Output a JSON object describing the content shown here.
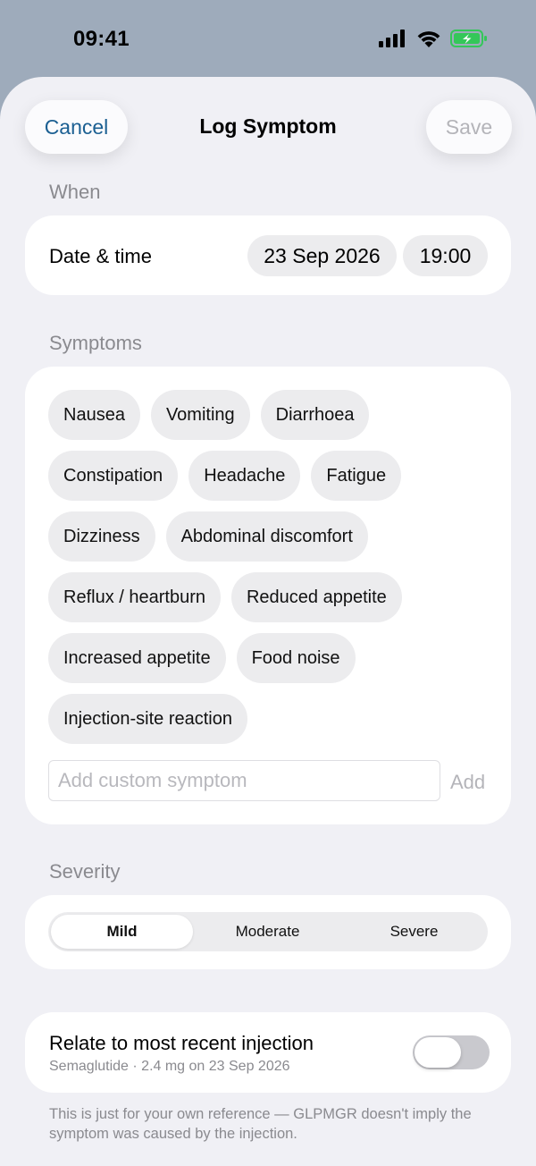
{
  "status": {
    "time": "09:41",
    "signal_icon": "cellular-signal-icon",
    "wifi_icon": "wifi-icon",
    "battery_icon": "battery-charging-icon",
    "battery_color": "#34c759"
  },
  "header": {
    "cancel_label": "Cancel",
    "title": "Log Symptom",
    "save_label": "Save",
    "accent_color": "#1b5f92"
  },
  "when": {
    "section_label": "When",
    "row_label": "Date & time",
    "date": "23 Sep 2026",
    "time": "19:00"
  },
  "symptoms": {
    "section_label": "Symptoms",
    "items": [
      "Nausea",
      "Vomiting",
      "Diarrhoea",
      "Constipation",
      "Headache",
      "Fatigue",
      "Dizziness",
      "Abdominal discomfort",
      "Reflux / heartburn",
      "Reduced appetite",
      "Increased appetite",
      "Food noise",
      "Injection-site reaction"
    ],
    "custom_placeholder": "Add custom symptom",
    "add_label": "Add"
  },
  "severity": {
    "section_label": "Severity",
    "options": [
      "Mild",
      "Moderate",
      "Severe"
    ],
    "selected": "Mild"
  },
  "relate": {
    "title": "Relate to most recent injection",
    "subtitle": "Semaglutide · 2.4 mg on 23 Sep 2026",
    "enabled": false
  },
  "footnote": "This is just for your own reference — GLPMGR doesn't imply the symptom was caused by the injection."
}
